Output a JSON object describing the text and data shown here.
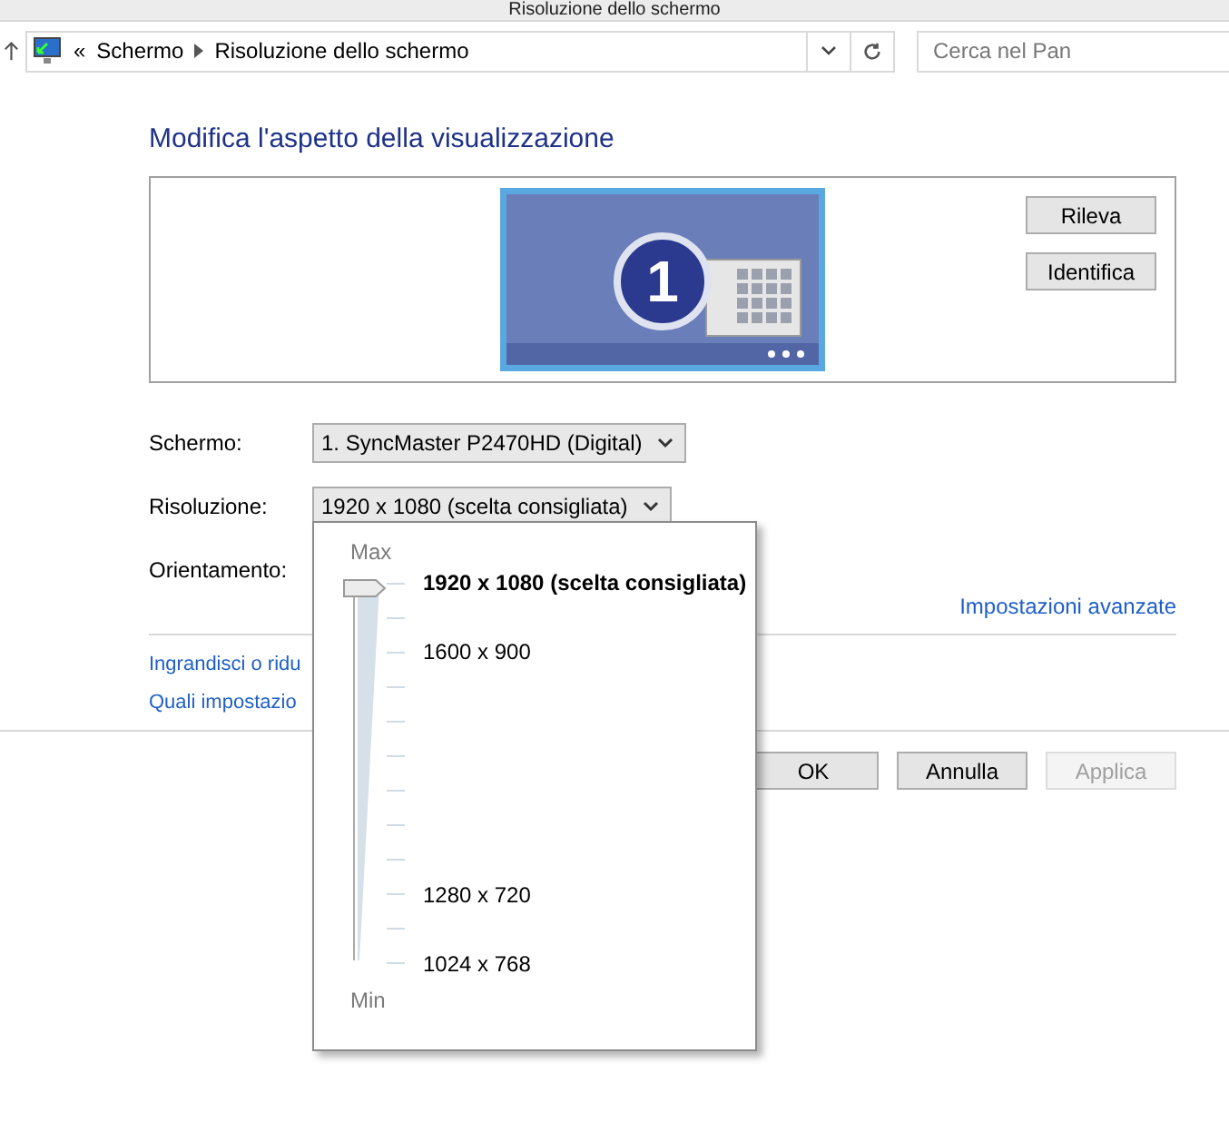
{
  "window": {
    "title": "Risoluzione dello schermo"
  },
  "address_bar": {
    "crumbs": [
      "Schermo",
      "Risoluzione dello schermo"
    ],
    "overflow": "«"
  },
  "search": {
    "placeholder": "Cerca nel Pan"
  },
  "heading": "Modifica l'aspetto della visualizzazione",
  "monitor": {
    "number": "1"
  },
  "side_buttons": [
    "Rileva",
    "Identifica"
  ],
  "fields": [
    {
      "label": "Schermo:",
      "value": "1. SyncMaster P2470HD (Digital)"
    },
    {
      "label": "Risoluzione:",
      "value": "1920 x 1080 (scelta consigliata)"
    },
    {
      "label": "Orientamento:"
    }
  ],
  "advanced_link": "Impostazioni avanzate",
  "links": [
    "Ingrandisci o ridu",
    "Quali impostazio"
  ],
  "buttons": [
    {
      "label": "OK",
      "disabled": false
    },
    {
      "label": "Annulla",
      "disabled": false
    },
    {
      "label": "Applica",
      "disabled": true
    }
  ],
  "resolution_popup": {
    "max_label": "Max",
    "min_label": "Min",
    "level": 1,
    "steps": [
      {
        "kind": "labelled",
        "label": "1920 x 1080 (scelta consigliata)",
        "selected": true
      },
      {
        "kind": "tick"
      },
      {
        "kind": "labelled",
        "label": "1600 x 900",
        "selected": false
      },
      {
        "kind": "tick"
      },
      {
        "kind": "tick"
      },
      {
        "kind": "tick"
      },
      {
        "kind": "tick"
      },
      {
        "kind": "tick"
      },
      {
        "kind": "tick"
      },
      {
        "kind": "labelled",
        "label": "1280 x 720",
        "selected": false
      },
      {
        "kind": "tick"
      },
      {
        "kind": "labelled",
        "label": "1024 x 768",
        "selected": false
      }
    ]
  }
}
